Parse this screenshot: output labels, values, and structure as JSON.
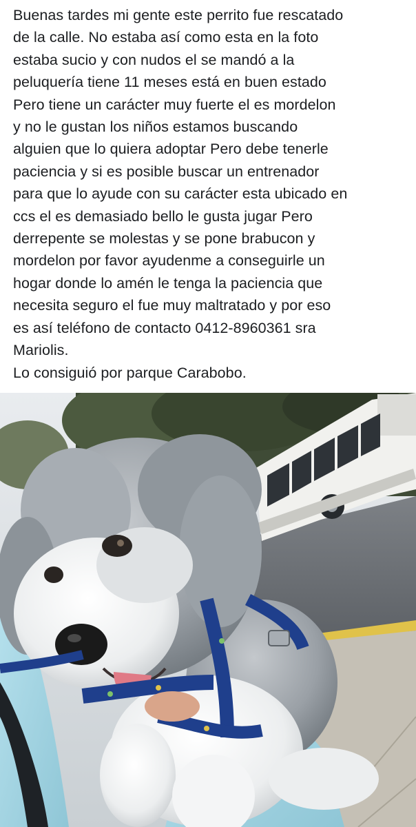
{
  "post": {
    "lines": [
      "Buenas tardes mi gente este perrito fue rescatado",
      "de la calle. No estaba así como esta en la foto",
      "estaba sucio y con nudos el se mandó a la",
      "peluquería tiene 11 meses está en buen estado",
      "Pero tiene un carácter muy fuerte el es mordelon",
      "y no le gustan los niños estamos buscando",
      "alguien que lo quiera adoptar Pero debe tenerle",
      "paciencia y si es posible buscar un entrenador",
      "para que lo ayude con su carácter esta ubicado en",
      "ccs el es demasiado bello le gusta jugar Pero",
      "derrepente se molestas y se pone brabucon y",
      "mordelon por favor ayudenme a conseguirle un",
      "hogar donde lo amén le tenga la paciencia que",
      "necesita seguro el fue muy maltratado y por eso",
      "es así teléfono de contacto  0412-8960361 sra",
      "Mariolis.",
      "Lo consiguió por parque Carabobo."
    ]
  },
  "photo": {
    "subject": "dog-photo",
    "colors": {
      "text": "#1c1e21",
      "fur_light": "#eef0f1",
      "fur_gray": "#9ea4aa",
      "harness": "#1f3f8c",
      "shirt": "#a9d8e6",
      "bus": "#f4f4f1"
    }
  }
}
